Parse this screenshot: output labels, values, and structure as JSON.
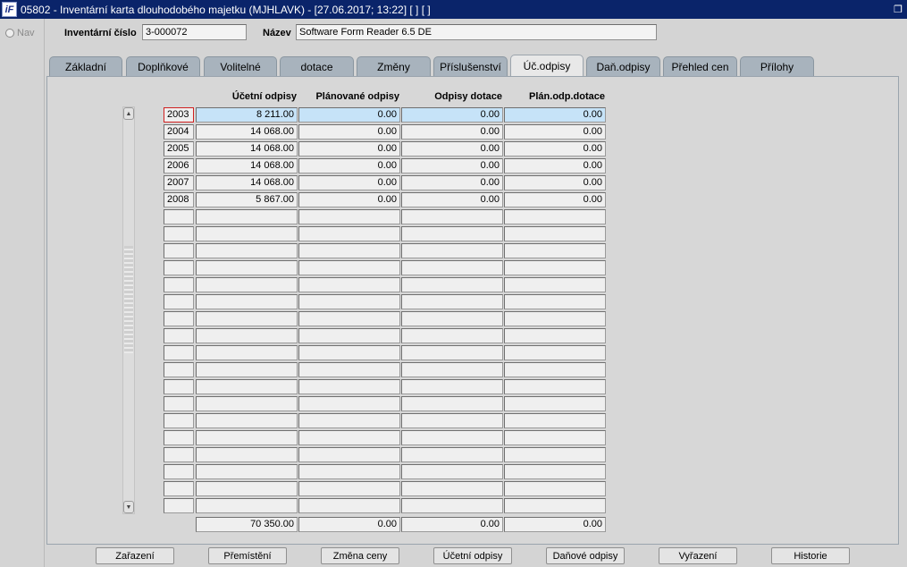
{
  "window": {
    "title": "05802 - Inventární karta dlouhodobého majetku (MJHLAVK) - [27.06.2017; 13:22]  [ ] [ ]",
    "icon_text": "iF",
    "restore_icon": "restore-icon",
    "close_icon": "close-icon"
  },
  "nav": {
    "label": "Nav"
  },
  "header": {
    "inv_label": "Inventární číslo",
    "inv_value": "3-000072",
    "name_label": "Název",
    "name_value": "Software Form Reader 6.5 DE"
  },
  "tabs": [
    {
      "label": "Základní"
    },
    {
      "label": "Doplňkové"
    },
    {
      "label": "Volitelné"
    },
    {
      "label": "dotace"
    },
    {
      "label": "Změny"
    },
    {
      "label": "Příslušenství"
    },
    {
      "label": "Úč.odpisy"
    },
    {
      "label": "Daň.odpisy"
    },
    {
      "label": "Přehled cen"
    },
    {
      "label": "Přílohy"
    }
  ],
  "active_tab": "Úč.odpisy",
  "columns": {
    "ucetni": "Účetní odpisy",
    "planovane": "Plánované odpisy",
    "dotace": "Odpisy dotace",
    "plan_dotace": "Plán.odp.dotace"
  },
  "rows": [
    {
      "year": "2003",
      "ucetni": "8 211.00",
      "planovane": "0.00",
      "dotace": "0.00",
      "plan_dotace": "0.00"
    },
    {
      "year": "2004",
      "ucetni": "14 068.00",
      "planovane": "0.00",
      "dotace": "0.00",
      "plan_dotace": "0.00"
    },
    {
      "year": "2005",
      "ucetni": "14 068.00",
      "planovane": "0.00",
      "dotace": "0.00",
      "plan_dotace": "0.00"
    },
    {
      "year": "2006",
      "ucetni": "14 068.00",
      "planovane": "0.00",
      "dotace": "0.00",
      "plan_dotace": "0.00"
    },
    {
      "year": "2007",
      "ucetni": "14 068.00",
      "planovane": "0.00",
      "dotace": "0.00",
      "plan_dotace": "0.00"
    },
    {
      "year": "2008",
      "ucetni": "5 867.00",
      "planovane": "0.00",
      "dotace": "0.00",
      "plan_dotace": "0.00"
    }
  ],
  "totals": {
    "ucetni": "70 350.00",
    "planovane": "0.00",
    "dotace": "0.00",
    "plan_dotace": "0.00"
  },
  "buttons": {
    "zarazeni": "Zařazení",
    "premisteni": "Přemístění",
    "zmena_ceny": "Změna ceny",
    "ucetni_odpisy": "Účetní odpisy",
    "danove_odpisy": "Daňové odpisy",
    "vyrazeni": "Vyřazení",
    "historie": "Historie"
  },
  "colors": {
    "title_bg": "#0a246a",
    "highlight": "#c6e3f8",
    "focus": "#d02020",
    "tab_bg": "#a8b3bd"
  }
}
